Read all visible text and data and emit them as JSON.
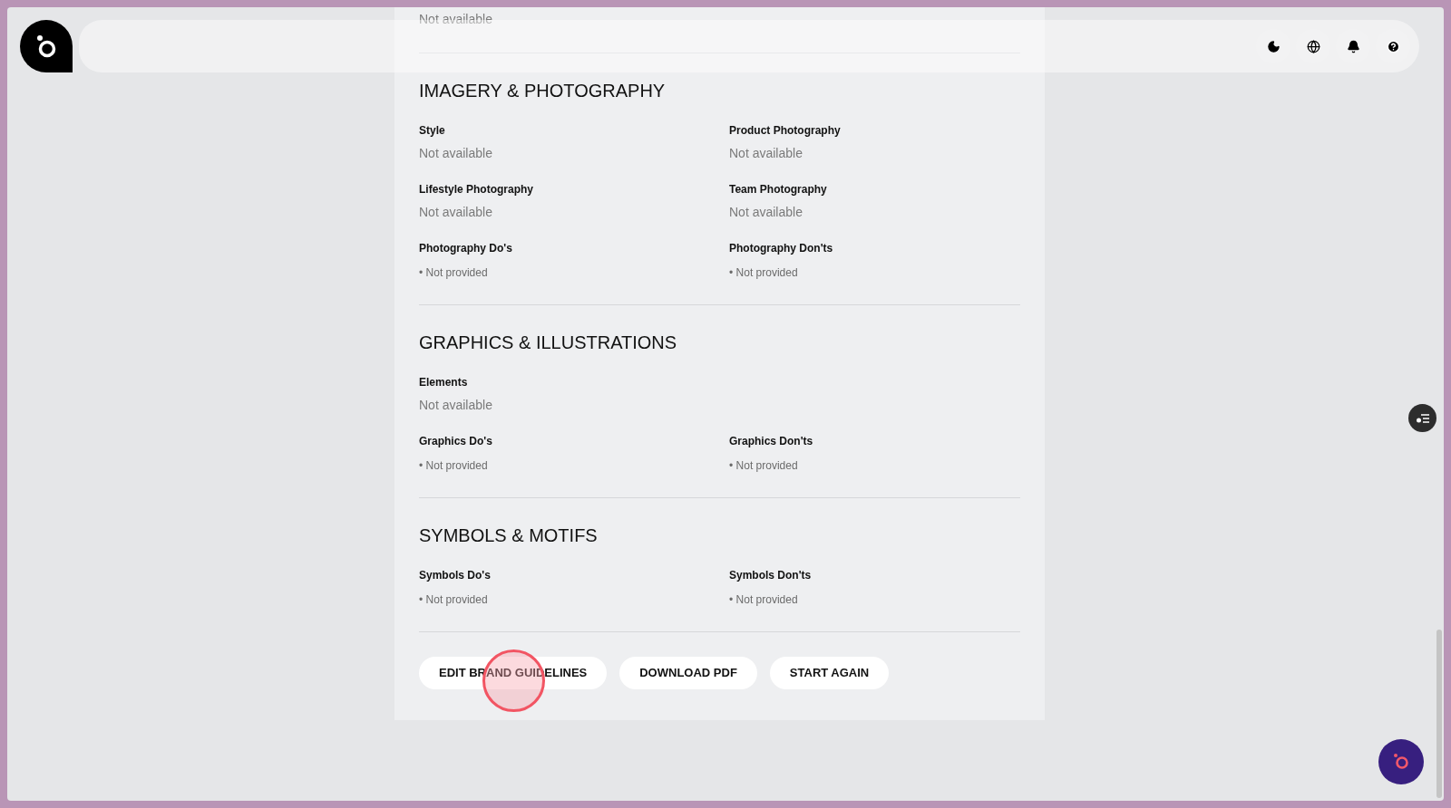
{
  "top_remnant": "Not available",
  "sections": [
    {
      "title": "IMAGERY & PHOTOGRAPHY",
      "fields": [
        {
          "label": "Style",
          "value": "Not available",
          "kind": "text",
          "full_width": false
        },
        {
          "label": "Product Photography",
          "value": "Not available",
          "kind": "text",
          "full_width": false
        },
        {
          "label": "Lifestyle Photography",
          "value": "Not available",
          "kind": "text",
          "full_width": false
        },
        {
          "label": "Team Photography",
          "value": "Not available",
          "kind": "text",
          "full_width": false
        },
        {
          "label": "Photography Do's",
          "value": "• Not provided",
          "kind": "bullet",
          "full_width": false
        },
        {
          "label": "Photography Don'ts",
          "value": "• Not provided",
          "kind": "bullet",
          "full_width": false
        }
      ]
    },
    {
      "title": "GRAPHICS & ILLUSTRATIONS",
      "fields": [
        {
          "label": "Elements",
          "value": "Not available",
          "kind": "text",
          "full_width": true
        },
        {
          "label": "Graphics Do's",
          "value": "• Not provided",
          "kind": "bullet",
          "full_width": false
        },
        {
          "label": "Graphics Don'ts",
          "value": "• Not provided",
          "kind": "bullet",
          "full_width": false
        }
      ]
    },
    {
      "title": "SYMBOLS & MOTIFS",
      "fields": [
        {
          "label": "Symbols Do's",
          "value": "• Not provided",
          "kind": "bullet",
          "full_width": false
        },
        {
          "label": "Symbols Don'ts",
          "value": "• Not provided",
          "kind": "bullet",
          "full_width": false
        }
      ]
    }
  ],
  "buttons": [
    {
      "label": "EDIT BRAND GUIDELINES",
      "click_marker": true
    },
    {
      "label": "DOWNLOAD PDF",
      "click_marker": false
    },
    {
      "label": "START AGAIN",
      "click_marker": false
    }
  ]
}
